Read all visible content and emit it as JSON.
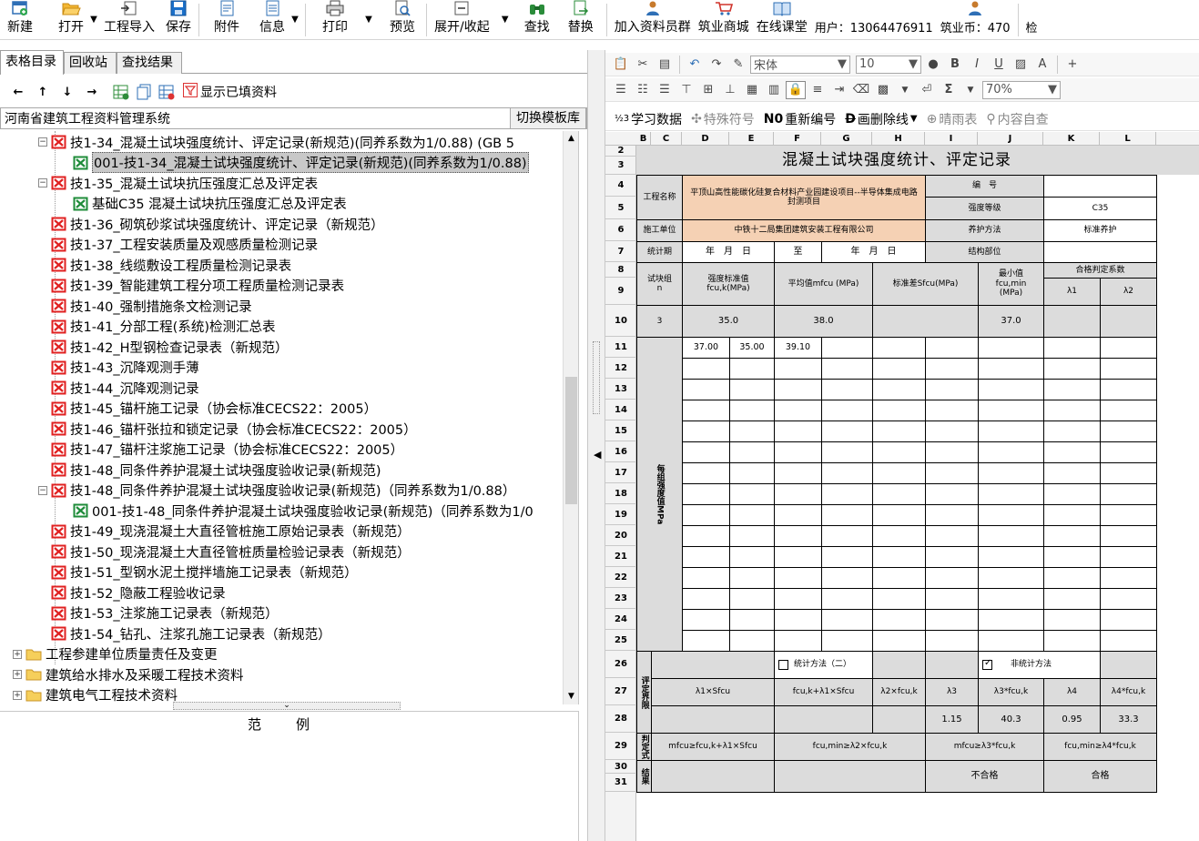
{
  "toolbar": {
    "new": "新建",
    "open": "打开",
    "import": "工程导入",
    "save": "保存",
    "attach": "附件",
    "info": "信息",
    "print": "打印",
    "preview": "预览",
    "expand": "展开/收起",
    "find": "查找",
    "replace": "替换",
    "join_group": "加入资料员群",
    "mall": "筑业商城",
    "classroom": "在线课堂",
    "user": "用户：13064476911",
    "coins": "筑业币：470",
    "check": "检"
  },
  "left_tabs": [
    "表格目录",
    "回收站",
    "查找结果"
  ],
  "left_tools": {
    "show_filled": "显示已填资料"
  },
  "system_name": "河南省建筑工程资料管理系统",
  "switch_library": "切换模板库",
  "tree": [
    {
      "label": "技1-34_混凝土试块强度统计、评定记录(新规范)(同养系数为1/0.88) (GB 5",
      "type": "red",
      "level": 1,
      "expander": "−"
    },
    {
      "label": "001-技1-34_混凝土试块强度统计、评定记录(新规范)(同养系数为1/0.88)",
      "type": "green",
      "level": 2,
      "selected": true
    },
    {
      "label": "技1-35_混凝土试块抗压强度汇总及评定表",
      "type": "red",
      "level": 1,
      "expander": "−"
    },
    {
      "label": "基础C35 混凝土试块抗压强度汇总及评定表",
      "type": "green",
      "level": 2
    },
    {
      "label": "技1-36_砌筑砂浆试块强度统计、评定记录（新规范）",
      "type": "red",
      "level": 1
    },
    {
      "label": "技1-37_工程安装质量及观感质量检测记录",
      "type": "red",
      "level": 1
    },
    {
      "label": "技1-38_线缆敷设工程质量检测记录表",
      "type": "red",
      "level": 1
    },
    {
      "label": "技1-39_智能建筑工程分项工程质量检测记录表",
      "type": "red",
      "level": 1
    },
    {
      "label": "技1-40_强制措施条文检测记录",
      "type": "red",
      "level": 1
    },
    {
      "label": "技1-41_分部工程(系统)检测汇总表",
      "type": "red",
      "level": 1
    },
    {
      "label": "技1-42_H型钢检查记录表（新规范）",
      "type": "red",
      "level": 1
    },
    {
      "label": "技1-43_沉降观测手薄",
      "type": "red",
      "level": 1
    },
    {
      "label": "技1-44_沉降观测记录",
      "type": "red",
      "level": 1
    },
    {
      "label": "技1-45_锚杆施工记录（协会标准CECS22：2005）",
      "type": "red",
      "level": 1
    },
    {
      "label": "技1-46_锚杆张拉和锁定记录（协会标准CECS22：2005）",
      "type": "red",
      "level": 1
    },
    {
      "label": "技1-47_锚杆注浆施工记录（协会标准CECS22：2005）",
      "type": "red",
      "level": 1
    },
    {
      "label": "技1-48_同条件养护混凝土试块强度验收记录(新规范)",
      "type": "red",
      "level": 1
    },
    {
      "label": "技1-48_同条件养护混凝土试块强度验收记录(新规范)（同养系数为1/0.88）",
      "type": "red",
      "level": 1,
      "expander": "−"
    },
    {
      "label": "001-技1-48_同条件养护混凝土试块强度验收记录(新规范)（同养系数为1/0",
      "type": "green",
      "level": 2
    },
    {
      "label": "技1-49_现浇混凝土大直径管桩施工原始记录表（新规范）",
      "type": "red",
      "level": 1
    },
    {
      "label": "技1-50_现浇混凝土大直径管桩质量检验记录表（新规范）",
      "type": "red",
      "level": 1
    },
    {
      "label": "技1-51_型钢水泥土搅拌墙施工记录表（新规范）",
      "type": "red",
      "level": 1
    },
    {
      "label": "技1-52_隐蔽工程验收记录",
      "type": "red",
      "level": 1
    },
    {
      "label": "技1-53_注浆施工记录表（新规范）",
      "type": "red",
      "level": 1
    },
    {
      "label": "技1-54_钻孔、注浆孔施工记录表（新规范）",
      "type": "red",
      "level": 1
    },
    {
      "label": "工程参建单位质量责任及变更",
      "type": "folder",
      "level": 0,
      "expander": "+"
    },
    {
      "label": "建筑给水排水及采暖工程技术资料",
      "type": "folder",
      "level": 0,
      "expander": "+"
    },
    {
      "label": "建筑电气工程技术资料",
      "type": "folder",
      "level": 0,
      "expander": "+"
    }
  ],
  "legend_title": "范例",
  "format_bar": {
    "font": "宋体",
    "size": "10",
    "zoom": "70%"
  },
  "tools3": {
    "learn": "学习数据",
    "special": "特殊符号",
    "renumber": "重新编号",
    "strike": "画删除线",
    "weather": "晴雨表",
    "selfcheck": "内容自查"
  },
  "sheet": {
    "columns": [
      "B",
      "C",
      "D",
      "E",
      "F",
      "G",
      "H",
      "I",
      "J",
      "K",
      "L"
    ],
    "rows": [
      "2",
      "3",
      "4",
      "5",
      "6",
      "7",
      "8",
      "9",
      "10",
      "11",
      "12",
      "13",
      "14",
      "15",
      "16",
      "17",
      "18",
      "19",
      "20",
      "21",
      "22",
      "23",
      "24",
      "25",
      "26",
      "27",
      "28",
      "29",
      "30",
      "31"
    ],
    "title": "混凝土试块强度统计、评定记录",
    "project_label": "工程名称",
    "project_name": "平顶山高性能碳化硅复合材料产业园建设项目--半导体集成电路封测项目",
    "code_label": "编　号",
    "grade_label": "强度等级",
    "grade": "C35",
    "unit_label": "施工单位",
    "unit_name": "中铁十二局集团建筑安装工程有限公司",
    "cure_label": "养护方法",
    "cure": "标准养护",
    "period_label": "统计期",
    "period_from": "年　月　日",
    "period_to_label": "至",
    "period_to": "年　月　日",
    "part_label": "结构部位",
    "group_label": "试块组\nn",
    "std_label": "强度标准值\nfcu,k(MPa)",
    "mean_label": "平均值mfcu (MPa)",
    "sd_label": "标准差Sfcu(MPa)",
    "min_label": "最小值\nfcu,min\n(MPa)",
    "coef_label": "合格判定系数",
    "l1": "λ1",
    "l2": "λ2",
    "n": "3",
    "std": "35.0",
    "mean": "38.0",
    "min": "37.0",
    "data_row": [
      "37.00",
      "35.00",
      "39.10"
    ],
    "strength_label": "每组强度值MPa",
    "eval_label": "评定界限",
    "stat2": "统计方法（二）",
    "nonstat": "非统计方法",
    "f1": "λ1×Sfcu",
    "f2": "fcu,k+λ1×Sfcu",
    "f3": "λ2×fcu,k",
    "f4": "λ3",
    "f5": "λ3*fcu,k",
    "f6": "λ4",
    "f7": "λ4*fcu,k",
    "v4": "1.15",
    "v5": "40.3",
    "v6": "0.95",
    "v7": "33.3",
    "judge_label": "判定式",
    "j1": "mfcu≥fcu,k+λ1×Sfcu",
    "j2": "fcu,min≥λ2×fcu,k",
    "j3": "mfcu≥λ3*fcu,k",
    "j4": "fcu,min≥λ4*fcu,k",
    "result_label": "结果",
    "r1": "不合格",
    "r2": "合格"
  },
  "colors": {
    "red_icon": "#e02020",
    "green_icon": "#1f8c3a",
    "orange_cell": "#f5d1b4",
    "grey_cell": "#dcdcdc"
  }
}
